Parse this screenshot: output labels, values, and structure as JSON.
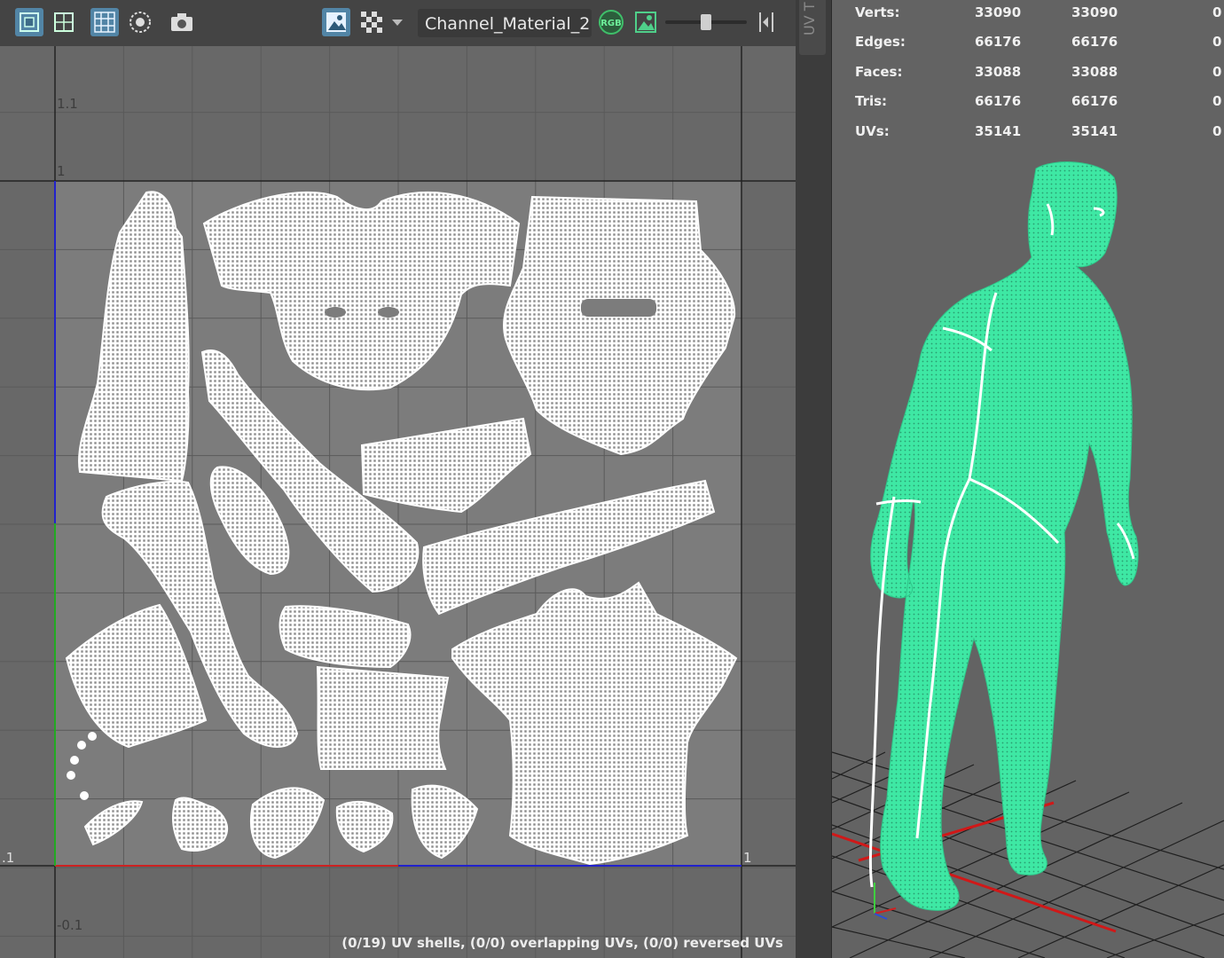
{
  "toolbar": {
    "material_name": "Channel_Material_2 (",
    "rgb_label": "RGB",
    "icons": [
      "uv-shell-icon",
      "uv-layout-icon",
      "grid-icon",
      "soft-select-icon",
      "snapshot-icon",
      "texture-display-icon",
      "checker-icon",
      "dropdown-arrow-icon",
      "rgb-channel-icon",
      "image-icon",
      "exposure-slider",
      "gamma-icon"
    ]
  },
  "uv_editor": {
    "tick_labels": {
      "v_1_1": "1.1",
      "v_1": "1",
      "u_neg": ".1",
      "u_1": "1",
      "v_neg_0_1": "-0.1"
    },
    "status": "(0/19) UV shells, (0/0) overlapping UVs, (0/0) reversed UVs",
    "colors": {
      "background": "#686868",
      "uv_tile": "#7c7c7c",
      "grid": "#5a5a5a",
      "wireframe": "#ffffff",
      "u_axis": "#cc2222",
      "v_axis_blue": "#2222cc",
      "v_axis_green": "#22aa22"
    }
  },
  "side_tab": {
    "label": "UV T"
  },
  "hud": {
    "rows": [
      {
        "label": "Verts:",
        "a": "33090",
        "b": "33090",
        "c": "0"
      },
      {
        "label": "Edges:",
        "a": "66176",
        "b": "66176",
        "c": "0"
      },
      {
        "label": "Faces:",
        "a": "33088",
        "b": "33088",
        "c": "0"
      },
      {
        "label": "Tris:",
        "a": "66176",
        "b": "66176",
        "c": "0"
      },
      {
        "label": "UVs:",
        "a": "35141",
        "b": "35141",
        "c": "0"
      }
    ]
  },
  "viewport": {
    "colors": {
      "background": "#636363",
      "mesh": "#3ee8a4",
      "seams": "#ffffff",
      "grid": "#1f1f1f",
      "grid_x_axis": "#d01818"
    }
  }
}
